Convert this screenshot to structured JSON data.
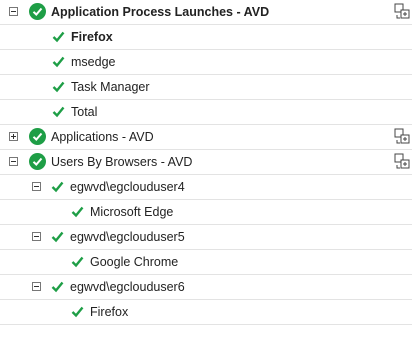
{
  "tree": {
    "group_avd_launches": {
      "label": "Application Process Launches - AVD",
      "expanded": true,
      "children": [
        "Firefox",
        "msedge",
        "Task Manager",
        "Total"
      ]
    },
    "group_applications": {
      "label": "Applications - AVD",
      "expanded": false
    },
    "group_users_browsers": {
      "label": "Users By Browsers - AVD",
      "expanded": true,
      "users": [
        {
          "label": "egwvd\\egclouduser4",
          "browser": "Microsoft Edge"
        },
        {
          "label": "egwvd\\egclouduser5",
          "browser": "Google Chrome"
        },
        {
          "label": "egwvd\\egclouduser6",
          "browser": "Firefox"
        }
      ]
    }
  },
  "colors": {
    "ok_green": "#1e9e46",
    "row_divider": "#e3e3e3",
    "text": "#222222"
  },
  "icons": {
    "status": "green-check-circle-icon",
    "child_status": "green-tick-icon",
    "expand": "plus-box-icon",
    "collapse": "minus-box-icon",
    "detach": "detach-window-icon"
  }
}
